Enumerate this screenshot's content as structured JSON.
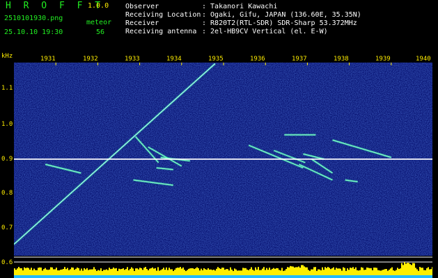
{
  "header": {
    "title": "H R O F F T",
    "version": "1.0.0",
    "file_name": "2510101930.png",
    "date_time": "25.10.10 19:30",
    "meteor_label": "meteor",
    "meteor_count": "56"
  },
  "info": [
    {
      "key": "Observer",
      "value": ": Takanori Kawachi"
    },
    {
      "key": "Receiving Location",
      "value": ": Ogaki, Gifu, JAPAN (136.60E, 35.35N)"
    },
    {
      "key": "Receiver",
      "value": ": R820T2(RTL-SDR) SDR-Sharp 53.372MHz"
    },
    {
      "key": "Receiving antenna",
      "value": ": 2el-HB9CV Vertical (el. E-W)"
    }
  ],
  "axis": {
    "unit": "kHz",
    "freq_ticks": [
      "1.1",
      "1.0",
      "0.9",
      "0.8",
      "0.7",
      "0.6"
    ],
    "time_ticks": [
      "1931",
      "1932",
      "1933",
      "1934",
      "1935",
      "1936",
      "1937",
      "1938",
      "1939",
      "1940"
    ]
  },
  "colors": {
    "background": "#000000",
    "noise": "#0a1a8c",
    "carrier": "#ffffff",
    "header_green": "#22ee22",
    "header_yellow": "#ffee00",
    "power_bar": "#ffee00",
    "power_bar_base": "#22bbff"
  },
  "echo_traces": [
    {
      "t0": 1930.0,
      "f0": 0.655,
      "t1": 1934.8,
      "f1": 1.175
    },
    {
      "t0": 1930.75,
      "f0": 0.885,
      "t1": 1931.6,
      "f1": 0.86
    },
    {
      "t0": 1932.9,
      "f0": 0.965,
      "t1": 1933.45,
      "f1": 0.89
    },
    {
      "t0": 1932.85,
      "f0": 0.84,
      "t1": 1933.8,
      "f1": 0.825
    },
    {
      "t0": 1933.2,
      "f0": 0.935,
      "t1": 1934.0,
      "f1": 0.88
    },
    {
      "t0": 1933.4,
      "f0": 0.875,
      "t1": 1933.8,
      "f1": 0.87
    },
    {
      "t0": 1933.5,
      "f0": 0.905,
      "t1": 1934.2,
      "f1": 0.895
    },
    {
      "t0": 1935.6,
      "f0": 0.94,
      "t1": 1936.9,
      "f1": 0.875
    },
    {
      "t0": 1936.2,
      "f0": 0.925,
      "t1": 1936.95,
      "f1": 0.89
    },
    {
      "t0": 1936.45,
      "f0": 0.97,
      "t1": 1937.2,
      "f1": 0.97
    },
    {
      "t0": 1936.8,
      "f0": 0.885,
      "t1": 1937.6,
      "f1": 0.84
    },
    {
      "t0": 1936.9,
      "f0": 0.915,
      "t1": 1937.4,
      "f1": 0.9
    },
    {
      "t0": 1937.1,
      "f0": 0.9,
      "t1": 1937.6,
      "f1": 0.86
    },
    {
      "t0": 1937.6,
      "f0": 0.955,
      "t1": 1939.0,
      "f1": 0.905
    },
    {
      "t0": 1937.9,
      "f0": 0.84,
      "t1": 1938.2,
      "f1": 0.835
    }
  ]
}
